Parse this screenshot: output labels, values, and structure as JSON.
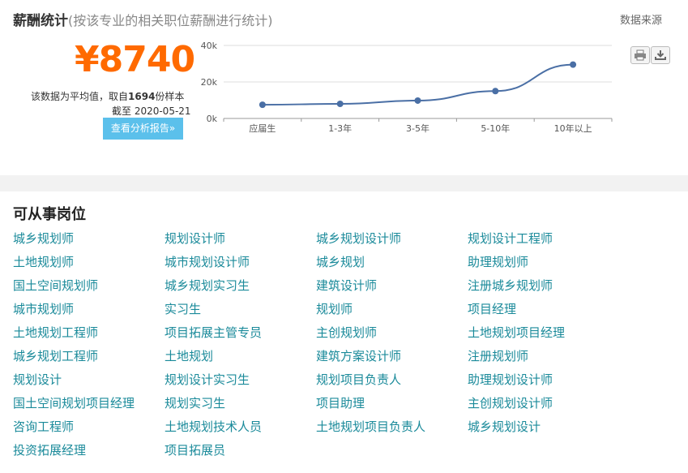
{
  "header": {
    "title": "薪酬统计",
    "subtitle": "(按该专业的相关职位薪酬进行统计)",
    "source_link": "数据来源"
  },
  "summary": {
    "salary": "¥8740",
    "note_prefix": "该数据为平均值，取自",
    "sample_count": "1694",
    "note_suffix": "份样本",
    "date_line": "截至 2020-05-21",
    "report_button": "查看分析报告»"
  },
  "toolbar": {
    "print_icon": "print-icon",
    "download_icon": "download-icon"
  },
  "chart_data": {
    "type": "line",
    "categories": [
      "应届生",
      "1-3年",
      "3-5年",
      "5-10年",
      "10年以上"
    ],
    "series": [
      {
        "values": [
          7500,
          8000,
          9800,
          15000,
          29500
        ]
      }
    ],
    "ylim": [
      0,
      40000
    ],
    "yticks": [
      "0k",
      "20k",
      "40k"
    ],
    "grid": true,
    "line_color": "#4a6fa5"
  },
  "jobs": {
    "title": "可从事岗位",
    "columns": [
      [
        "城乡规划师",
        "土地规划师",
        "国土空间规划师",
        "城市规划师",
        "土地规划工程师",
        "城乡规划工程师",
        "规划设计",
        "国土空间规划项目经理",
        "咨询工程师",
        "投资拓展经理"
      ],
      [
        "规划设计师",
        "城市规划设计师",
        "城乡规划实习生",
        "实习生",
        "项目拓展主管专员",
        "土地规划",
        "规划设计实习生",
        "规划实习生",
        "土地规划技术人员",
        "项目拓展员"
      ],
      [
        "城乡规划设计师",
        "城乡规划",
        "建筑设计师",
        "规划师",
        "主创规划师",
        "建筑方案设计师",
        "规划项目负责人",
        "项目助理",
        "土地规划项目负责人"
      ],
      [
        "规划设计工程师",
        "助理规划师",
        "注册城乡规划师",
        "项目经理",
        "土地规划项目经理",
        "注册规划师",
        "助理规划设计师",
        "主创规划设计师",
        "城乡规划设计"
      ]
    ]
  }
}
